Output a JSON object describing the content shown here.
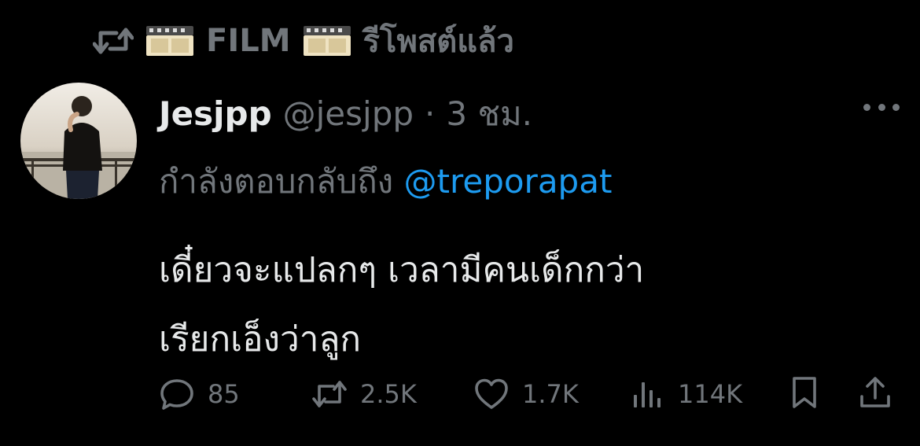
{
  "repost": {
    "icon": "repost-icon",
    "film_emoji": "film-frames-icon",
    "label_name": "FILM",
    "label_suffix": "รีโพสต์แล้ว"
  },
  "tweet": {
    "author_name": "Jesjpp",
    "author_handle": "@jesjpp",
    "separator": "·",
    "time_ago": "3 ชม.",
    "reply_prefix": "กำลังตอบกลับถึง",
    "reply_to": "@treporapat",
    "text_line1": "เดี๋ยวจะแปลกๆ เวลามีคนเด็กกว่า",
    "text_line2": "เรียกเอ็งว่าลูก"
  },
  "actions": {
    "reply_count": "85",
    "repost_count": "2.5K",
    "like_count": "1.7K",
    "view_count": "114K"
  },
  "colors": {
    "background": "#000000",
    "text": "#e7e9ea",
    "secondary": "#71767b",
    "link": "#1d9bf0"
  }
}
